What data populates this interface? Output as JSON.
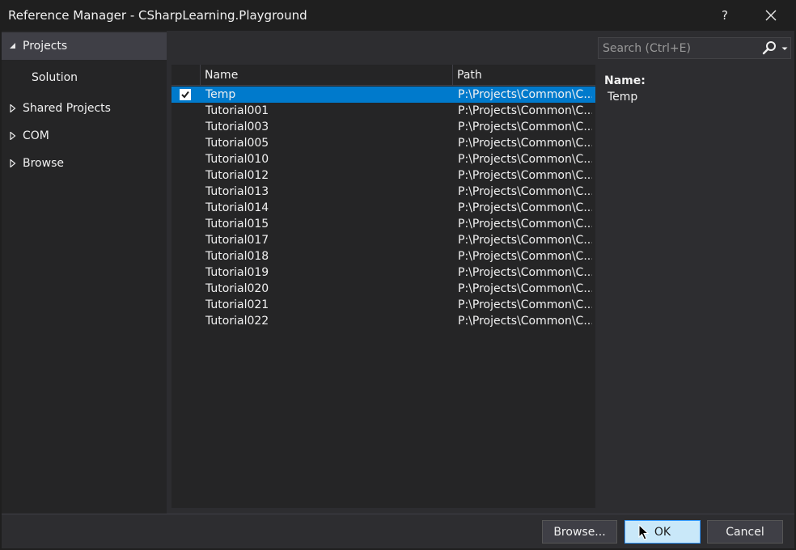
{
  "window": {
    "title": "Reference Manager - CSharpLearning.Playground",
    "help_label": "?",
    "close_label": "✕"
  },
  "nav": {
    "items": [
      {
        "label": "Projects",
        "expanded": true
      },
      {
        "label": "Solution"
      },
      {
        "label": "Shared Projects",
        "expanded": false
      },
      {
        "label": "COM",
        "expanded": false
      },
      {
        "label": "Browse",
        "expanded": false
      }
    ]
  },
  "search": {
    "placeholder": "Search (Ctrl+E)",
    "value": ""
  },
  "grid": {
    "columns": {
      "name": "Name",
      "path": "Path"
    },
    "rows": [
      {
        "name": "Temp",
        "path": "P:\\Projects\\Common\\C...",
        "checked": true,
        "selected": true
      },
      {
        "name": "Tutorial001",
        "path": "P:\\Projects\\Common\\C..."
      },
      {
        "name": "Tutorial003",
        "path": "P:\\Projects\\Common\\C..."
      },
      {
        "name": "Tutorial005",
        "path": "P:\\Projects\\Common\\C..."
      },
      {
        "name": "Tutorial010",
        "path": "P:\\Projects\\Common\\C..."
      },
      {
        "name": "Tutorial012",
        "path": "P:\\Projects\\Common\\C..."
      },
      {
        "name": "Tutorial013",
        "path": "P:\\Projects\\Common\\C..."
      },
      {
        "name": "Tutorial014",
        "path": "P:\\Projects\\Common\\C..."
      },
      {
        "name": "Tutorial015",
        "path": "P:\\Projects\\Common\\C..."
      },
      {
        "name": "Tutorial017",
        "path": "P:\\Projects\\Common\\C..."
      },
      {
        "name": "Tutorial018",
        "path": "P:\\Projects\\Common\\C..."
      },
      {
        "name": "Tutorial019",
        "path": "P:\\Projects\\Common\\C..."
      },
      {
        "name": "Tutorial020",
        "path": "P:\\Projects\\Common\\C..."
      },
      {
        "name": "Tutorial021",
        "path": "P:\\Projects\\Common\\C..."
      },
      {
        "name": "Tutorial022",
        "path": "P:\\Projects\\Common\\C..."
      }
    ]
  },
  "details": {
    "label": "Name:",
    "value": "Temp"
  },
  "buttons": {
    "browse": "Browse...",
    "ok": "OK",
    "cancel": "Cancel"
  },
  "colors": {
    "accent": "#007acc",
    "background": "#2d2d30",
    "panel": "#252526",
    "ok_button": "#c9e8f9"
  }
}
